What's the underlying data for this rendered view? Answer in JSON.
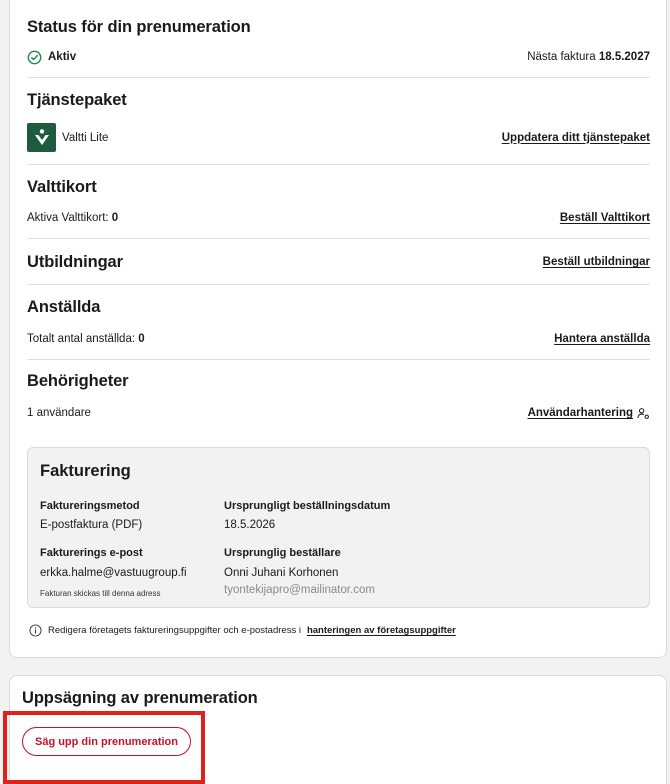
{
  "subscription": {
    "title": "Status för din prenumeration",
    "status": "Aktiv",
    "next_invoice_label": "Nästa faktura",
    "next_invoice_date": "18.5.2027"
  },
  "package": {
    "title": "Tjänstepaket",
    "name": "Valtti Lite",
    "update_link": "Uppdatera ditt tjänstepaket"
  },
  "cards": {
    "title": "Valttikort",
    "active_label": "Aktiva Valttikort:",
    "active_count": "0",
    "order_link": "Beställ Valttikort"
  },
  "trainings": {
    "title": "Utbildningar",
    "order_link": "Beställ utbildningar"
  },
  "employees": {
    "title": "Anställda",
    "total_label": "Totalt antal anställda:",
    "total_count": "0",
    "manage_link": "Hantera anställda"
  },
  "permissions": {
    "title": "Behörigheter",
    "users_text": "1 användare",
    "manage_link": "Användarhantering"
  },
  "billing": {
    "title": "Fakturering",
    "method_label": "Faktureringsmetod",
    "method_value": "E-postfaktura (PDF)",
    "order_date_label": "Ursprungligt beställningsdatum",
    "order_date_value": "18.5.2026",
    "email_label": "Fakturerings e-post",
    "email_value": "erkka.halme@vastuugroup.fi",
    "email_note": "Fakturan skickas till denna adress",
    "orderer_label": "Ursprunglig beställare",
    "orderer_name": "Onni Juhani Korhonen",
    "orderer_email": "tyontekijapro@mailinator.com"
  },
  "info": {
    "text": "Redigera företagets faktureringsuppgifter och e-postadress i",
    "link": "hanteringen av företagsuppgifter"
  },
  "cancellation": {
    "title": "Uppsägning av prenumeration",
    "button": "Säg upp din prenumeration"
  },
  "colors": {
    "accent_red": "#c8102e",
    "status_green": "#1f8a4c",
    "brand_green": "#1f5c3f"
  }
}
